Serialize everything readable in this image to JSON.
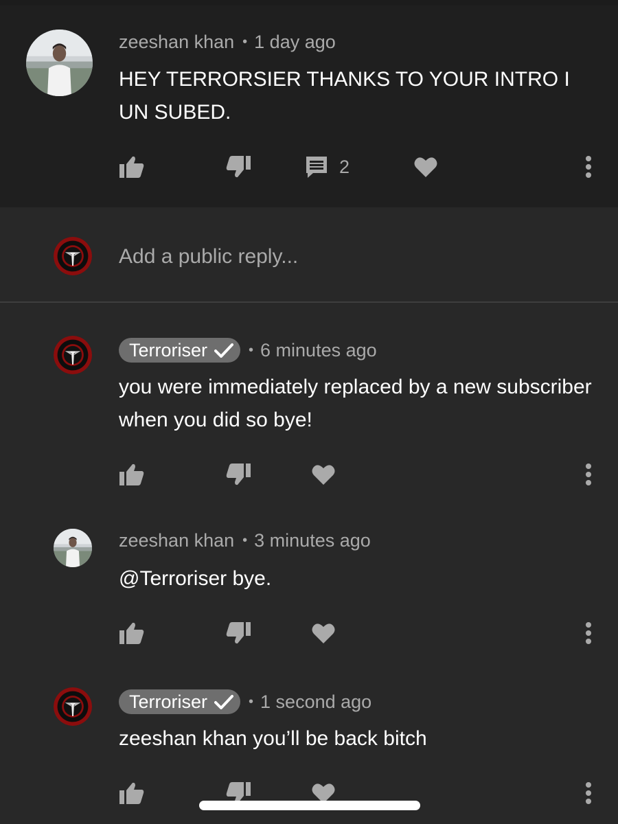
{
  "top_comment": {
    "author": "zeeshan khan",
    "time": "1 day ago",
    "text": "HEY TERRORSIER THANKS TO YOUR INTRO I UN SUBED.",
    "reply_count": "2"
  },
  "reply_box": {
    "placeholder": "Add a public reply..."
  },
  "replies": [
    {
      "author": "Terroriser",
      "verified": true,
      "time": "6 minutes ago",
      "text": "you were immediately replaced by a new subscriber when you did so bye!"
    },
    {
      "author": "zeeshan khan",
      "verified": false,
      "time": "3 minutes ago",
      "text": "@Terroriser bye."
    },
    {
      "author": "Terroriser",
      "verified": true,
      "time": "1 second ago",
      "text": "zeeshan khan you’ll be back bitch"
    }
  ],
  "separator": "•",
  "icons": {
    "like": "thumbs-up-icon",
    "dislike": "thumbs-down-icon",
    "reply": "comment-icon",
    "heart": "heart-icon",
    "more": "more-vertical-icon",
    "verified": "checkmark-icon"
  },
  "colors": {
    "background": "#282828",
    "top_comment_background": "#1f1f1f",
    "secondary_text": "#aaaaaa",
    "badge": "#6e6e6e",
    "logo_red": "#8b0d0d"
  }
}
